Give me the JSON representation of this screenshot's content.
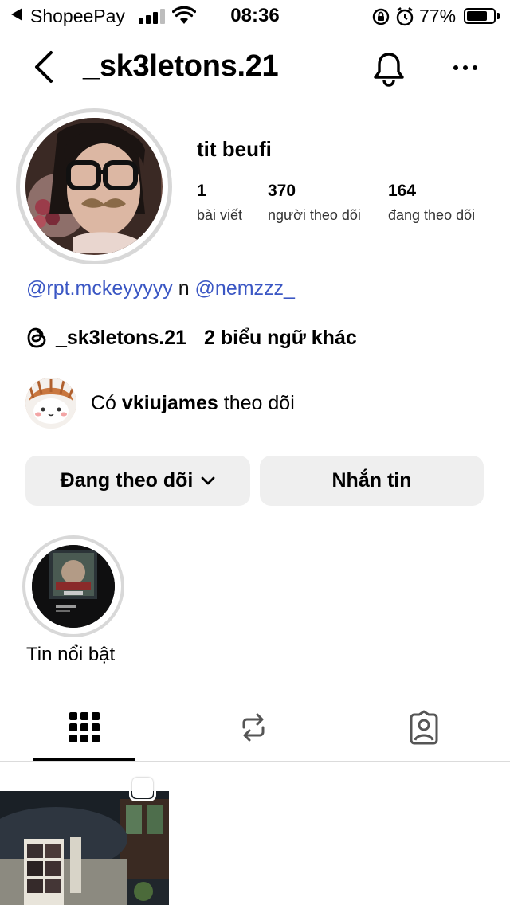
{
  "status_bar": {
    "carrier": "ShopeePay",
    "time": "08:36",
    "battery_percent": "77%",
    "battery_level": 0.77
  },
  "header": {
    "username": "_sk3letons.21"
  },
  "profile": {
    "display_name": "tit beufi",
    "stats": [
      {
        "value": "1",
        "label": "bài viết"
      },
      {
        "value": "370",
        "label": "người theo dõi"
      },
      {
        "value": "164",
        "label": "đang theo dõi"
      }
    ],
    "bio": {
      "mention_1": "@rpt.mckeyyyyy",
      "connector": "n",
      "mention_2": "@nemzzz_"
    },
    "threads": {
      "handle": "_sk3letons.21",
      "more": "2 biểu ngữ khác"
    },
    "followed_by": {
      "prefix": "Có",
      "name": "vkiujames",
      "suffix": "theo dõi"
    }
  },
  "actions": {
    "following_label": "Đang theo dõi",
    "message_label": "Nhắn tin"
  },
  "highlights": [
    {
      "label": "Tin nổi bật"
    }
  ],
  "tabs": [
    {
      "icon": "grid-icon",
      "active": true
    },
    {
      "icon": "reels-repost-icon",
      "active": false
    },
    {
      "icon": "tagged-icon",
      "active": false
    }
  ],
  "colors": {
    "mention": "#3b57c4",
    "button_bg": "#efefef",
    "ring": "#d8d8d8"
  }
}
